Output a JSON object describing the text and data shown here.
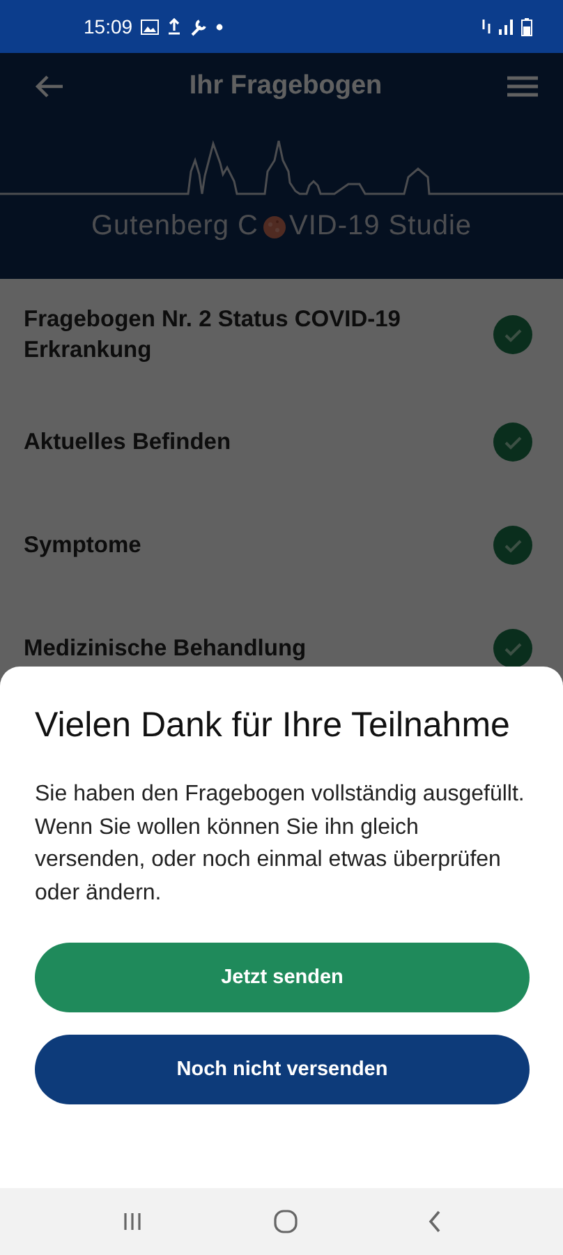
{
  "status_bar": {
    "time": "15:09"
  },
  "app_bar": {
    "title": "Ihr Fragebogen"
  },
  "banner": {
    "logo_text_start": "Gutenberg C",
    "logo_text_end": "VID-19 Studie"
  },
  "sections": [
    {
      "label": "Fragebogen Nr. 2 Status COVID-19 Erkrankung",
      "completed": true
    },
    {
      "label": "Aktuelles Befinden",
      "completed": true
    },
    {
      "label": "Symptome",
      "completed": true
    },
    {
      "label": "Medizinische Behandlung",
      "completed": true
    }
  ],
  "dialog": {
    "title": "Vielen Dank für Ihre Teilnahme",
    "message": "Sie haben den Fragebogen vollständig ausgefüllt. Wenn Sie wollen können Sie ihn gleich versenden, oder noch einmal etwas überprüfen oder ändern.",
    "buttons": [
      {
        "label": "Jetzt senden",
        "kind": "primary"
      },
      {
        "label": "Noch nicht versenden",
        "kind": "secondary"
      }
    ]
  }
}
